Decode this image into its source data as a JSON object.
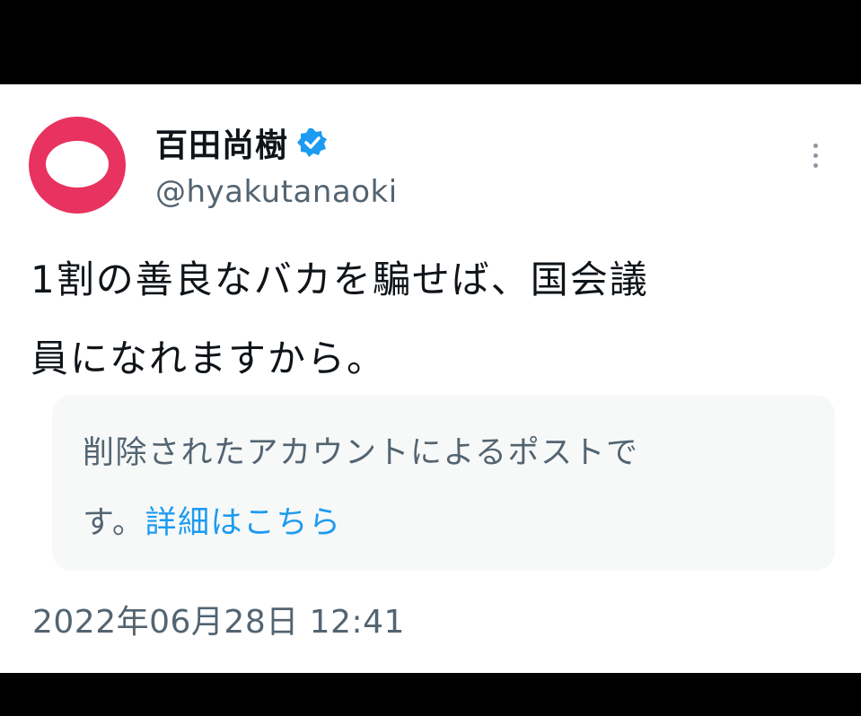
{
  "post": {
    "display_name": "百田尚樹",
    "handle": "@hyakutanaoki",
    "verified_icon": "verified-badge-icon",
    "more_icon": "more-vertical-icon",
    "text_line1": "1割の善良なバカを騙せば、国会議",
    "text_line2": "員になれますから。",
    "notice": {
      "line1": "削除されたアカウントによるポストで",
      "line2_prefix": "す。",
      "link": "詳細はこちら"
    },
    "timestamp": "2022年06月28日 12:41"
  },
  "colors": {
    "avatar": "#e8325f",
    "verified": "#1d9bf0",
    "link": "#1d9bf0",
    "secondary_text": "#536471",
    "notice_bg": "#f7f9f9"
  }
}
